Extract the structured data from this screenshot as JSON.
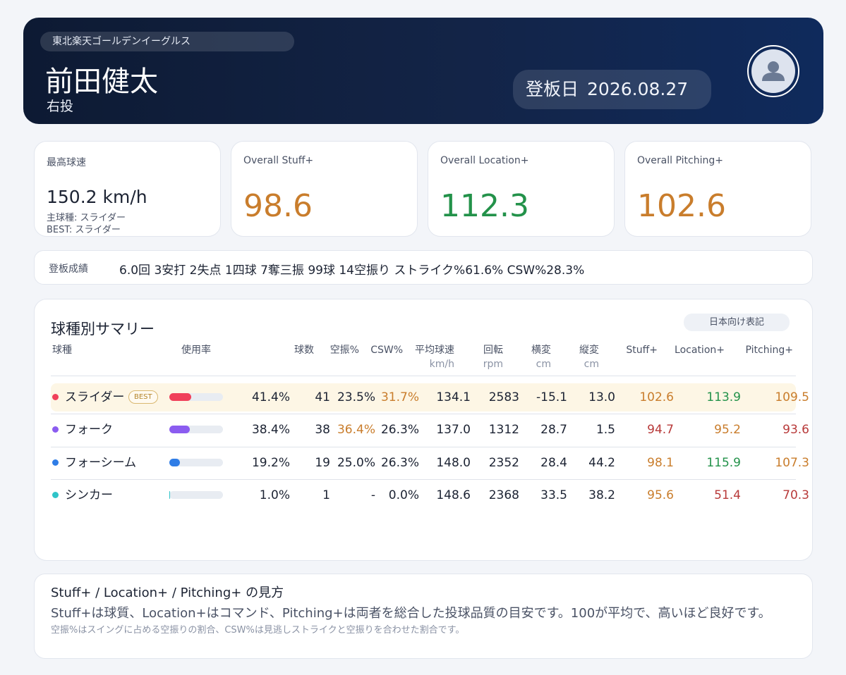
{
  "header": {
    "team": "東北楽天ゴールデンイーグルス",
    "player_name": "前田健太",
    "throws": "右投",
    "date_label": "登板日",
    "date_value": "2026.08.27",
    "avatar_icon": "user-icon"
  },
  "stats": {
    "max_velo_label": "最高球速",
    "max_velo_value": "150.2 km/h",
    "main_pitch": "主球種: スライダー",
    "best_pitch": "BEST: スライダー",
    "stuff_label": "Overall Stuff+",
    "stuff_value": "98.6",
    "location_label": "Overall Location+",
    "location_value": "112.3",
    "pitching_label": "Overall Pitching+",
    "pitching_value": "102.6"
  },
  "record": {
    "label": "登板成績",
    "text": "6.0回 3安打 2失点 1四球 7奪三振 99球 14空振り ストライク%61.6% CSW%28.3%"
  },
  "summary": {
    "title": "球種別サマリー",
    "jp_label": "日本向け表記",
    "headers": {
      "pitch": "球種",
      "usage": "使用率",
      "count": "球数",
      "whiff": "空振%",
      "csw": "CSW%",
      "velo": "平均球速",
      "velo_unit": "km/h",
      "spin": "回転",
      "spin_unit": "rpm",
      "hbreak": "横変",
      "hbreak_unit": "cm",
      "vbreak": "縦変",
      "vbreak_unit": "cm",
      "stuff": "Stuff+",
      "location": "Location+",
      "pitching": "Pitching+"
    },
    "best_badge": "BEST",
    "rows": [
      {
        "name": "スライダー",
        "color": "#f0405a",
        "usage": "41.4%",
        "usage_frac": 0.414,
        "count": "41",
        "whiff": "23.5%",
        "csw": "31.7%",
        "velo": "134.1",
        "spin": "2583",
        "hbreak": "-15.1",
        "vbreak": "13.0",
        "stuff": "102.6",
        "location": "113.9",
        "pitching": "109.5"
      },
      {
        "name": "フォーク",
        "color": "#8b5cf0",
        "usage": "38.4%",
        "usage_frac": 0.384,
        "count": "38",
        "whiff": "36.4%",
        "csw": "26.3%",
        "velo": "137.0",
        "spin": "1312",
        "hbreak": "28.7",
        "vbreak": "1.5",
        "stuff": "94.7",
        "location": "95.2",
        "pitching": "93.6"
      },
      {
        "name": "フォーシーム",
        "color": "#2f7de6",
        "usage": "19.2%",
        "usage_frac": 0.192,
        "count": "19",
        "whiff": "25.0%",
        "csw": "26.3%",
        "velo": "148.0",
        "spin": "2352",
        "hbreak": "28.4",
        "vbreak": "44.2",
        "stuff": "98.1",
        "location": "115.9",
        "pitching": "107.3"
      },
      {
        "name": "シンカー",
        "color": "#2fc4c8",
        "usage": "1.0%",
        "usage_frac": 0.01,
        "count": "1",
        "whiff": "-",
        "csw": "0.0%",
        "velo": "148.6",
        "spin": "2368",
        "hbreak": "33.5",
        "vbreak": "38.2",
        "stuff": "95.6",
        "location": "51.4",
        "pitching": "70.3"
      }
    ]
  },
  "explain": {
    "title": "Stuff+ / Location+ / Pitching+ の見方",
    "main": "Stuff+は球質、Location+はコマンド、Pitching+は両者を総合した投球品質の目安です。100が平均で、高いほど良好です。",
    "sub": "空振%はスイングに占める空振りの割合、CSW%は見逃しストライクと空振りを合わせた割合です。"
  },
  "colors": {
    "good": "#23924a",
    "mid": "#c97d2c",
    "bad": "#b83a3a"
  }
}
